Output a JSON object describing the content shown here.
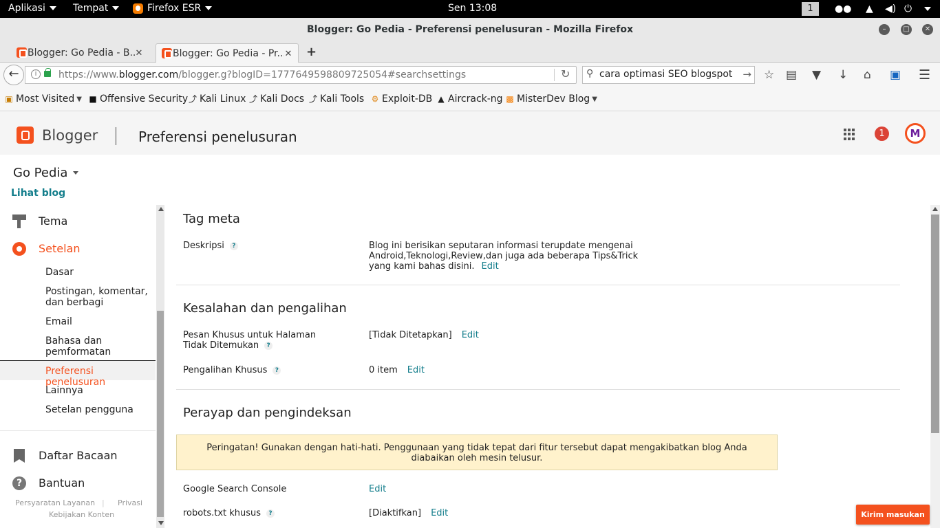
{
  "system_bar": {
    "apps_menu": "Aplikasi",
    "places_menu": "Tempat",
    "active_app": "Firefox ESR",
    "clock": "Sen 13:08",
    "workspace": "1"
  },
  "window": {
    "title": "Blogger: Go Pedia - Preferensi penelusuran - Mozilla Firefox"
  },
  "tabs": [
    {
      "label": "Blogger: Go Pedia - B...",
      "active": false
    },
    {
      "label": "Blogger: Go Pedia - Pr...",
      "active": true
    }
  ],
  "navbar": {
    "url_prefix": "https://www.",
    "url_domain": "blogger.com",
    "url_path": "/blogger.g?blogID=1777649598809725054#searchsettings",
    "search_value": "cara optimasi SEO blogspot"
  },
  "bookmarks": [
    {
      "label": "Most Visited",
      "icon": "folder-icon",
      "dropdown": true
    },
    {
      "label": "Offensive Security",
      "icon": "offsec-icon",
      "dropdown": false
    },
    {
      "label": "Kali Linux",
      "icon": "kali-dragon-icon",
      "dropdown": false
    },
    {
      "label": "Kali Docs",
      "icon": "kali-dragon-icon",
      "dropdown": false
    },
    {
      "label": "Kali Tools",
      "icon": "kali-dragon-icon",
      "dropdown": false
    },
    {
      "label": "Exploit-DB",
      "icon": "exploit-db-icon",
      "dropdown": false
    },
    {
      "label": "Aircrack-ng",
      "icon": "aircrack-icon",
      "dropdown": false
    },
    {
      "label": "MisterDev Blog",
      "icon": "rss-icon",
      "dropdown": true
    }
  ],
  "header": {
    "app_name": "Blogger",
    "page_title": "Preferensi penelusuran",
    "notification_count": "1",
    "brand_color": "#f4511e"
  },
  "sidebar": {
    "blog_name": "Go Pedia",
    "view_blog": "Lihat blog",
    "theme": "Tema",
    "settings": "Setelan",
    "settings_items": [
      "Dasar",
      "Postingan, komentar, dan berbagi",
      "Email",
      "Bahasa dan pemformatan",
      "Preferensi penelusuran",
      "Lainnya",
      "Setelan pengguna"
    ],
    "reading_list": "Daftar Bacaan",
    "help": "Bantuan",
    "footer": {
      "terms": "Persyaratan Layanan",
      "privacy": "Privasi",
      "content_policy": "Kebijakan Konten"
    }
  },
  "main": {
    "meta_tags": {
      "title": "Tag meta",
      "description_label": "Deskripsi",
      "description_value": "Blog ini berisikan seputaran informasi terupdate mengenai Android,Teknologi,Review,dan juga ada beberapa Tips&Trick yang kami bahas disini.",
      "edit": "Edit"
    },
    "errors": {
      "title": "Kesalahan dan pengalihan",
      "not_found_label": "Pesan Khusus untuk Halaman Tidak Ditemukan",
      "not_found_value": "[Tidak Ditetapkan]",
      "redirects_label": "Pengalihan Khusus",
      "redirects_value": "0 item",
      "edit": "Edit"
    },
    "crawlers": {
      "title": "Perayap dan pengindeksan",
      "warning": "Peringatan! Gunakan dengan hati-hati. Penggunaan yang tidak tepat dari fitur tersebut dapat mengakibatkan blog Anda diabaikan oleh mesin telusur.",
      "search_console_label": "Google Search Console",
      "robots_label": "robots.txt khusus",
      "robots_value": "[Diaktifkan]",
      "edit": "Edit"
    }
  },
  "feedback_button": "Kirim masukan"
}
